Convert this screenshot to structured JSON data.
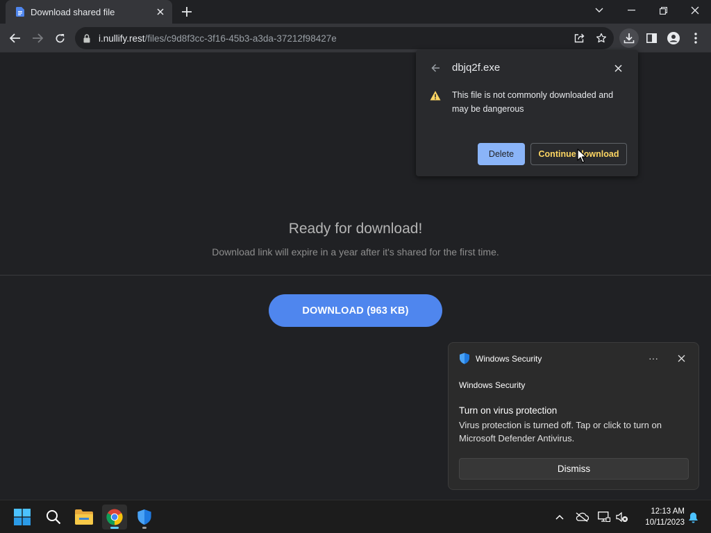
{
  "browser": {
    "tab_title": "Download shared file",
    "url_host": "i.nullify.rest",
    "url_path": "/files/c9d8f3cc-3f16-45b3-a3da-37212f98427e"
  },
  "download_bubble": {
    "filename": "dbjq2f.exe",
    "warning": "This file is not commonly downloaded and may be dangerous",
    "delete_label": "Delete",
    "continue_label": "Continue download"
  },
  "page": {
    "title": "Ready for download!",
    "subtitle": "Download link will expire in a year after it's shared for the first time.",
    "download_button": "DOWNLOAD (963 KB)"
  },
  "toast": {
    "app_name": "Windows Security",
    "more_label": "···",
    "sender": "Windows Security",
    "headline": "Turn on virus protection",
    "body": "Virus protection is turned off. Tap or click to turn on Microsoft Defender Antivirus.",
    "dismiss_label": "Dismiss"
  },
  "taskbar": {
    "time": "12:13 AM",
    "date": "10/11/2023",
    "apps": [
      "start-icon",
      "search-icon",
      "file-explorer-icon",
      "chrome-icon",
      "windows-security-icon"
    ]
  },
  "colors": {
    "accent_button": "#4f86ee",
    "delete_button": "#8ab4f8",
    "continue_text": "#fdd663",
    "warning": "#fdd663"
  }
}
